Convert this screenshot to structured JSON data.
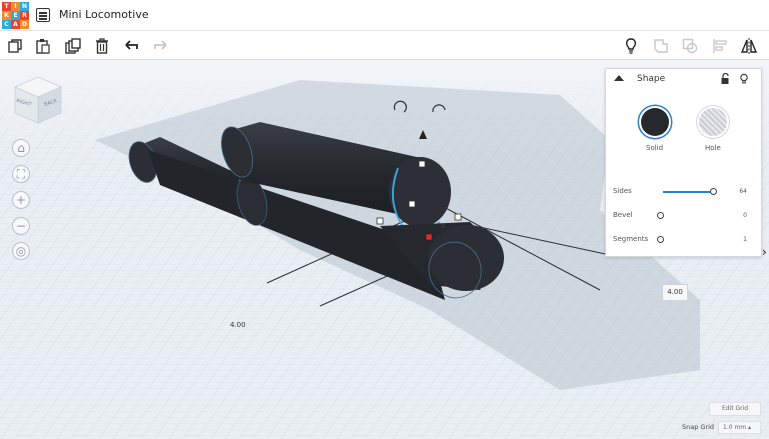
{
  "app": {
    "logo_letters": [
      "T",
      "I",
      "N",
      "K",
      "E",
      "R",
      "C",
      "A",
      "D"
    ],
    "logo_colors": [
      "#e8432c",
      "#f08c2b",
      "#2fa9e0",
      "#f08c2b",
      "#2fa9e0",
      "#e8432c",
      "#2fa9e0",
      "#e8432c",
      "#f08c2b"
    ],
    "title": "Mini Locomotive"
  },
  "toolbar": {
    "copy_icon": "copy-icon",
    "paste_icon": "paste-icon",
    "duplicate_icon": "duplicate-icon",
    "delete_icon": "trash-icon",
    "undo_icon": "undo-icon",
    "redo_icon": "redo-icon",
    "right_tools": [
      "lightbulb-icon",
      "group-icon",
      "ungroup-icon",
      "align-icon",
      "mirror-icon"
    ]
  },
  "viewcube": {
    "faces": [
      "RIGHT",
      "BACK"
    ]
  },
  "nav": [
    "home-icon",
    "fit-icon",
    "zoom-in-icon",
    "zoom-out-icon",
    "ortho-icon"
  ],
  "shape_panel": {
    "title": "Shape",
    "solid_label": "Solid",
    "hole_label": "Hole",
    "solid_color": "#25282d",
    "params": [
      {
        "label": "Sides",
        "value": "64",
        "fraction": 1.0
      },
      {
        "label": "Bevel",
        "value": "0",
        "fraction": 0.0
      },
      {
        "label": "Segments",
        "value": "1",
        "fraction": 0.0
      }
    ]
  },
  "dimensions": {
    "right": "4.00",
    "left": "4.00"
  },
  "footer": {
    "edit_grid": "Edit Grid",
    "snap_label": "Snap Grid",
    "snap_value": "1.0 mm ▴"
  },
  "colors": {
    "accent": "#2a7fd6",
    "selection": "#3aa7e0",
    "body": "#25282d"
  }
}
